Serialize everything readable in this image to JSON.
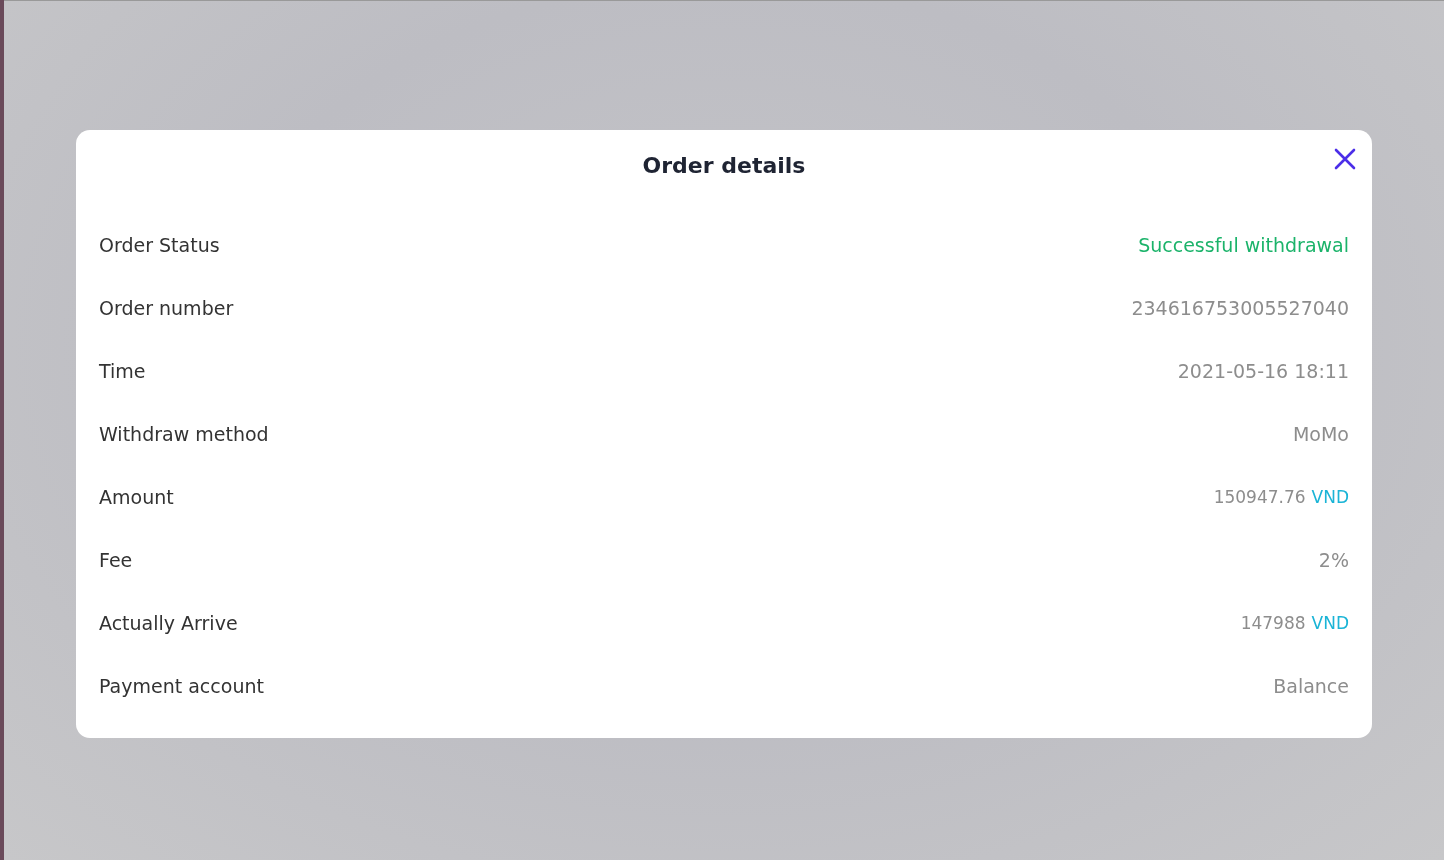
{
  "dialog": {
    "title": "Order details",
    "rows": [
      {
        "label": "Order Status",
        "kind": "status",
        "value": "Successful withdrawal"
      },
      {
        "label": "Order number",
        "kind": "plain",
        "value": "234616753005527040"
      },
      {
        "label": "Time",
        "kind": "plain",
        "value": "2021-05-16 18:11"
      },
      {
        "label": "Withdraw method",
        "kind": "plain",
        "value": "MoMo"
      },
      {
        "label": "Amount",
        "kind": "money",
        "value": "150947.76",
        "currency": "VND"
      },
      {
        "label": "Fee",
        "kind": "plain",
        "value": "2%"
      },
      {
        "label": "Actually Arrive",
        "kind": "money",
        "value": "147988",
        "currency": "VND"
      },
      {
        "label": "Payment account",
        "kind": "plain",
        "value": "Balance"
      }
    ]
  }
}
